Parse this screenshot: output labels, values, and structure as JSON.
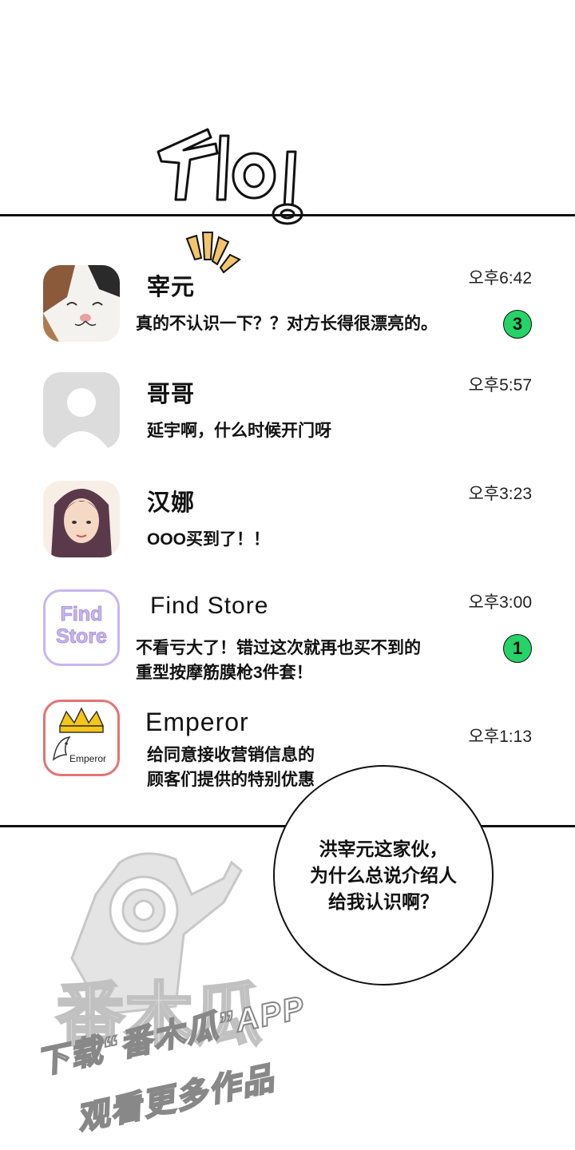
{
  "sfx": {
    "text": "지이잉"
  },
  "chats": [
    {
      "name": "宰元",
      "time": "오후6:42",
      "preview": "真的不认识一下？？对方长得很漂亮的。",
      "unread": "3",
      "avatar_icon": "cat-avatar-icon"
    },
    {
      "name": "哥哥",
      "time": "오후5:57",
      "preview": "延宇啊，什么时候开门呀",
      "unread": "",
      "avatar_icon": "default-avatar-icon"
    },
    {
      "name": "汉娜",
      "time": "오후3:23",
      "preview": "OOO买到了！！",
      "unread": "",
      "avatar_icon": "woman-avatar-icon"
    },
    {
      "name": "Find Store",
      "time": "오후3:00",
      "preview": "不看亏大了！错过这次就再也买不到的\n重型按摩筋膜枪3件套！",
      "unread": "1",
      "avatar_icon": "find-store-logo-icon",
      "logo_text": "Find\nStore"
    },
    {
      "name": "Emperor",
      "time": "오후1:13",
      "preview": "给同意接收营销信息的\n顾客们提供的特别优惠",
      "unread": "",
      "avatar_icon": "emperor-logo-icon",
      "logo_text": "Emperor"
    }
  ],
  "bubble": {
    "text": "洪宰元这家伙，\n为什么总说介绍人\n给我认识啊？"
  },
  "watermark": {
    "logo": "番木瓜",
    "line1": "下载“番木瓜”APP",
    "line2": "观看更多作品"
  },
  "colors": {
    "badge": "#25d366",
    "findstore": "#c7b6f0",
    "emperor": "#e57373"
  }
}
